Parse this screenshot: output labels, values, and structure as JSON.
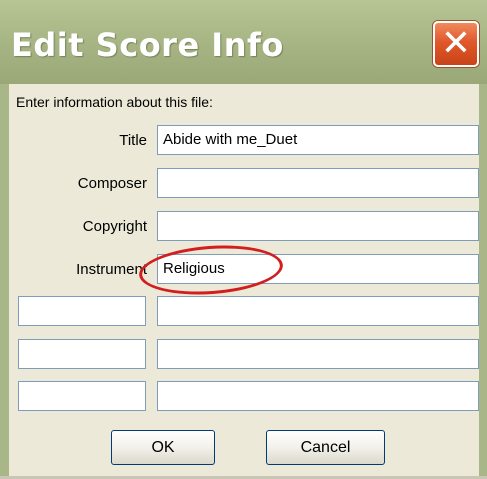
{
  "window": {
    "title": "Edit Score Info",
    "close_glyph": "✕"
  },
  "dialog": {
    "intro": "Enter information about this file:",
    "fields": [
      {
        "label": "Title",
        "value": "Abide with me_Duet"
      },
      {
        "label": "Composer",
        "value": ""
      },
      {
        "label": "Copyright",
        "value": ""
      },
      {
        "label": "Instrument",
        "value": "Religious"
      }
    ],
    "custom_rows": [
      {
        "label": "",
        "value": ""
      },
      {
        "label": "",
        "value": ""
      },
      {
        "label": "",
        "value": ""
      }
    ],
    "ok_label": "OK",
    "cancel_label": "Cancel"
  },
  "colors": {
    "titlebar": "#a6b483",
    "client": "#ece9d8",
    "highlight": "#d21e1e",
    "close_button": "#e0582c"
  },
  "icons": [
    "close-icon"
  ]
}
